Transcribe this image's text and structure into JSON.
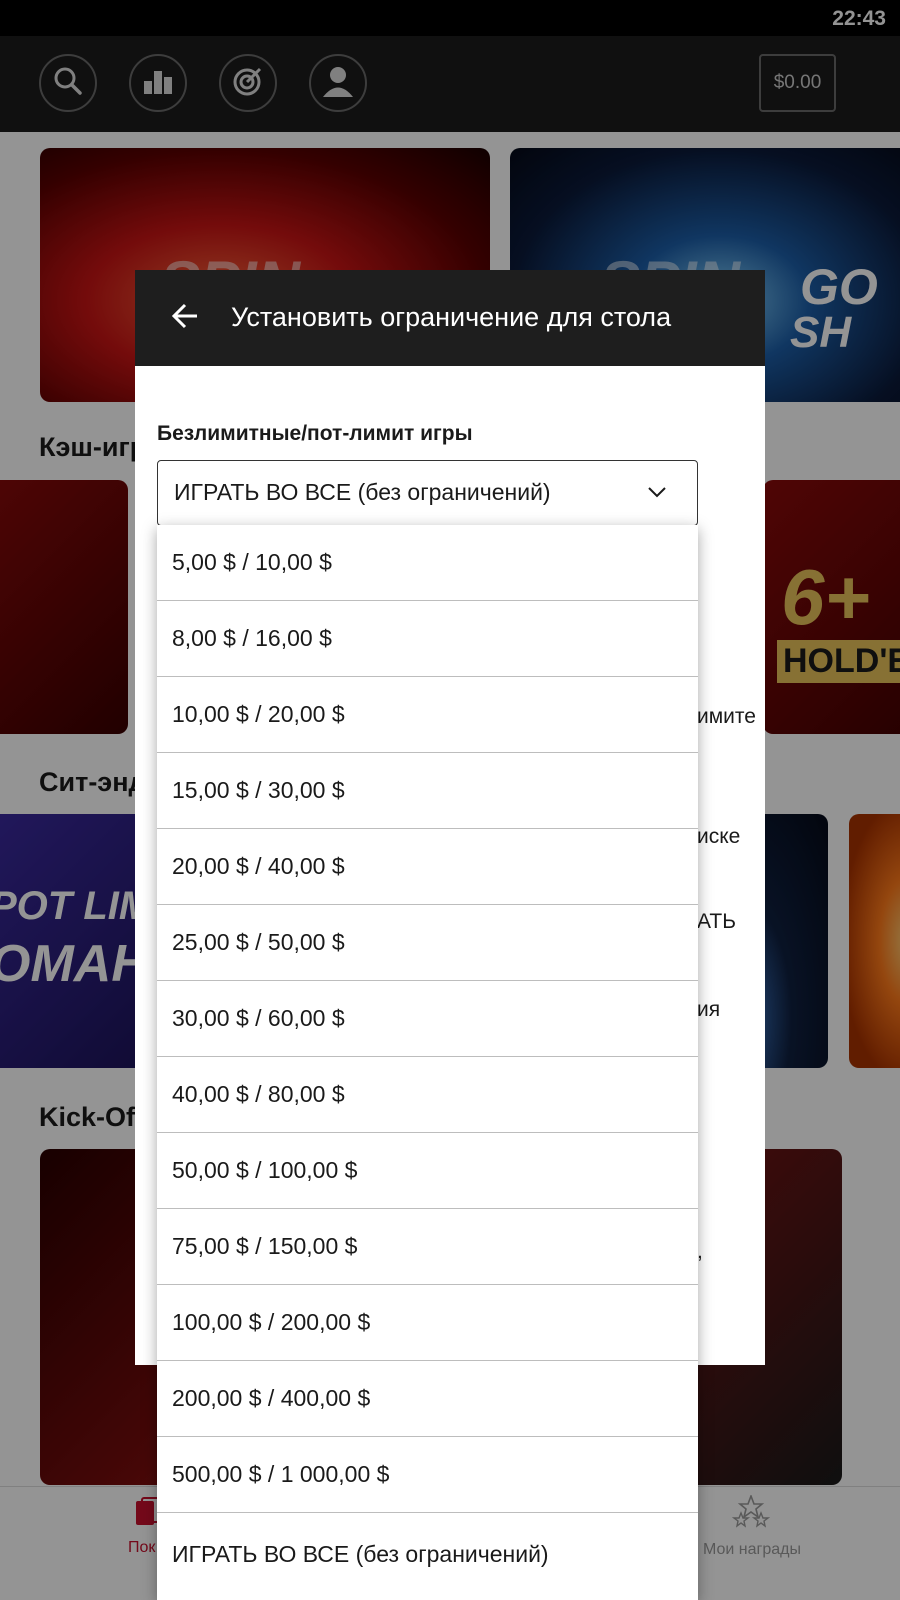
{
  "status_bar": {
    "time": "22:43"
  },
  "topbar": {
    "balance": "$0.00"
  },
  "lobby": {
    "sections": [
      "Кэш-игр",
      "Сит-энд",
      "Kick-Off"
    ],
    "tile_texts": [
      "SPIN",
      "GO",
      "SH",
      "6+",
      "HOLD'EM",
      "POT LIMIT",
      "OMAHA"
    ]
  },
  "bottom_nav": {
    "left_label": "Пок",
    "rewards_label": "Мои награды"
  },
  "dialog": {
    "title": "Установить ограничение для стола",
    "field_label": "Безлимитные/пот-лимит игры",
    "selected_value": "ИГРАТЬ ВО ВСЕ (без ограничений)",
    "behind_fragments": [
      "имите",
      "иске",
      "АТЬ",
      "ия",
      ","
    ]
  },
  "dropdown": {
    "options": [
      "5,00 $ / 10,00 $",
      "8,00 $ / 16,00 $",
      "10,00 $ / 20,00 $",
      "15,00 $ / 30,00 $",
      "20,00 $ / 40,00 $",
      "25,00 $ / 50,00 $",
      "30,00 $ / 60,00 $",
      "40,00 $ / 80,00 $",
      "50,00 $ / 100,00 $",
      "75,00 $ / 150,00 $",
      "100,00 $ / 200,00 $",
      "200,00 $ / 400,00 $",
      "500,00 $ / 1 000,00 $",
      "ИГРАТЬ ВО ВСЕ (без ограничений)"
    ]
  },
  "colors": {
    "accent": "#c8102e",
    "header": "#1e1e1e"
  }
}
